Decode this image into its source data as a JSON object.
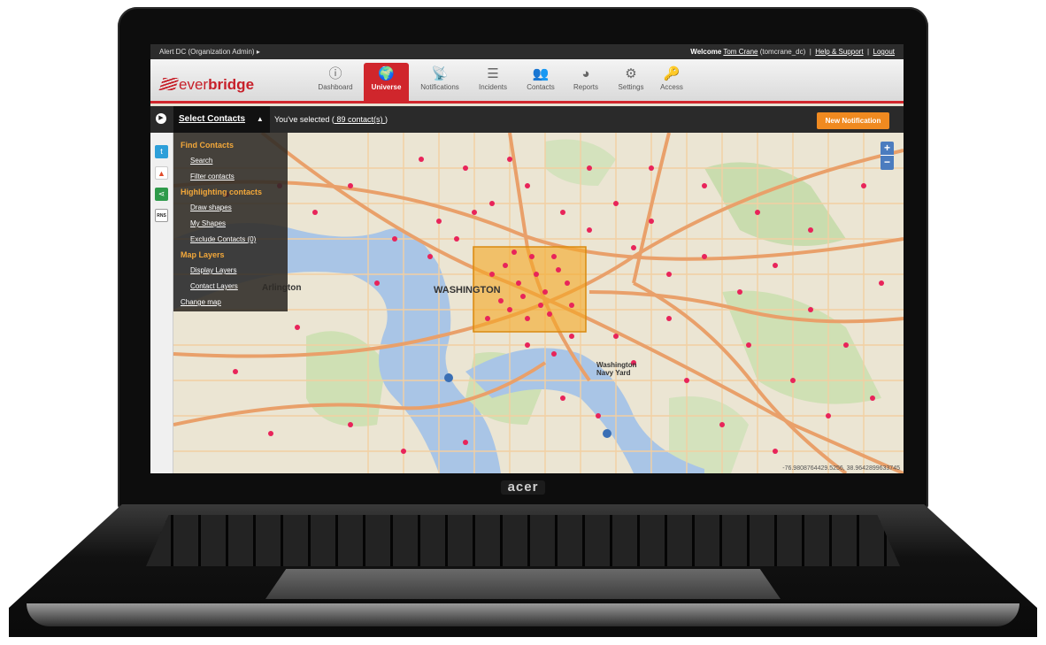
{
  "device": {
    "logo": "acer"
  },
  "topbar": {
    "org": "Alert DC (Organization Admin)",
    "welcome": "Welcome",
    "user": "Tom Crane",
    "user_id": "(tomcrane_dc)",
    "help": "Help & Support",
    "logout": "Logout",
    "separator": "|"
  },
  "brand": {
    "a": "ever",
    "b": "bridge"
  },
  "nav": [
    {
      "label": "Dashboard",
      "icon": "ⓘ"
    },
    {
      "label": "Universe",
      "icon": "🌍"
    },
    {
      "label": "Notifications",
      "icon": "📡"
    },
    {
      "label": "Incidents",
      "icon": "☰"
    },
    {
      "label": "Contacts",
      "icon": "👥"
    },
    {
      "label": "Reports",
      "icon": "◕"
    },
    {
      "label": "Settings",
      "icon": "⚙"
    },
    {
      "label": "Access",
      "icon": "🔑"
    }
  ],
  "subbar": {
    "select_label": "Select Contacts",
    "caret": "▲",
    "selected_prefix": "You've selected (",
    "selected_count": " 89 contact(s) ",
    "selected_suffix": ")",
    "new_notification": "New Notification"
  },
  "menu": {
    "find": "Find Contacts",
    "search": "Search",
    "filter": "Filter contacts",
    "highlight": "Highlighting contacts",
    "draw": "Draw shapes",
    "my_shapes": "My Shapes",
    "exclude": "Exclude Contacts (0)",
    "layers": "Map Layers",
    "display_layers": "Display Layers",
    "contact_layers": "Contact Layers",
    "change_map": "Change map"
  },
  "map": {
    "city": "WASHINGTON",
    "arlington": "Arlington",
    "navy_yard_1": "Washington",
    "navy_yard_2": "Navy Yard",
    "zoom_in": "+",
    "zoom_out": "−",
    "coords": "-76.9808764429.5256, 38.9642899633745"
  },
  "colors": {
    "accent": "#d0262c",
    "orange": "#f08a20",
    "contact_dot": "#e8245a",
    "selection": "#f5a623"
  }
}
